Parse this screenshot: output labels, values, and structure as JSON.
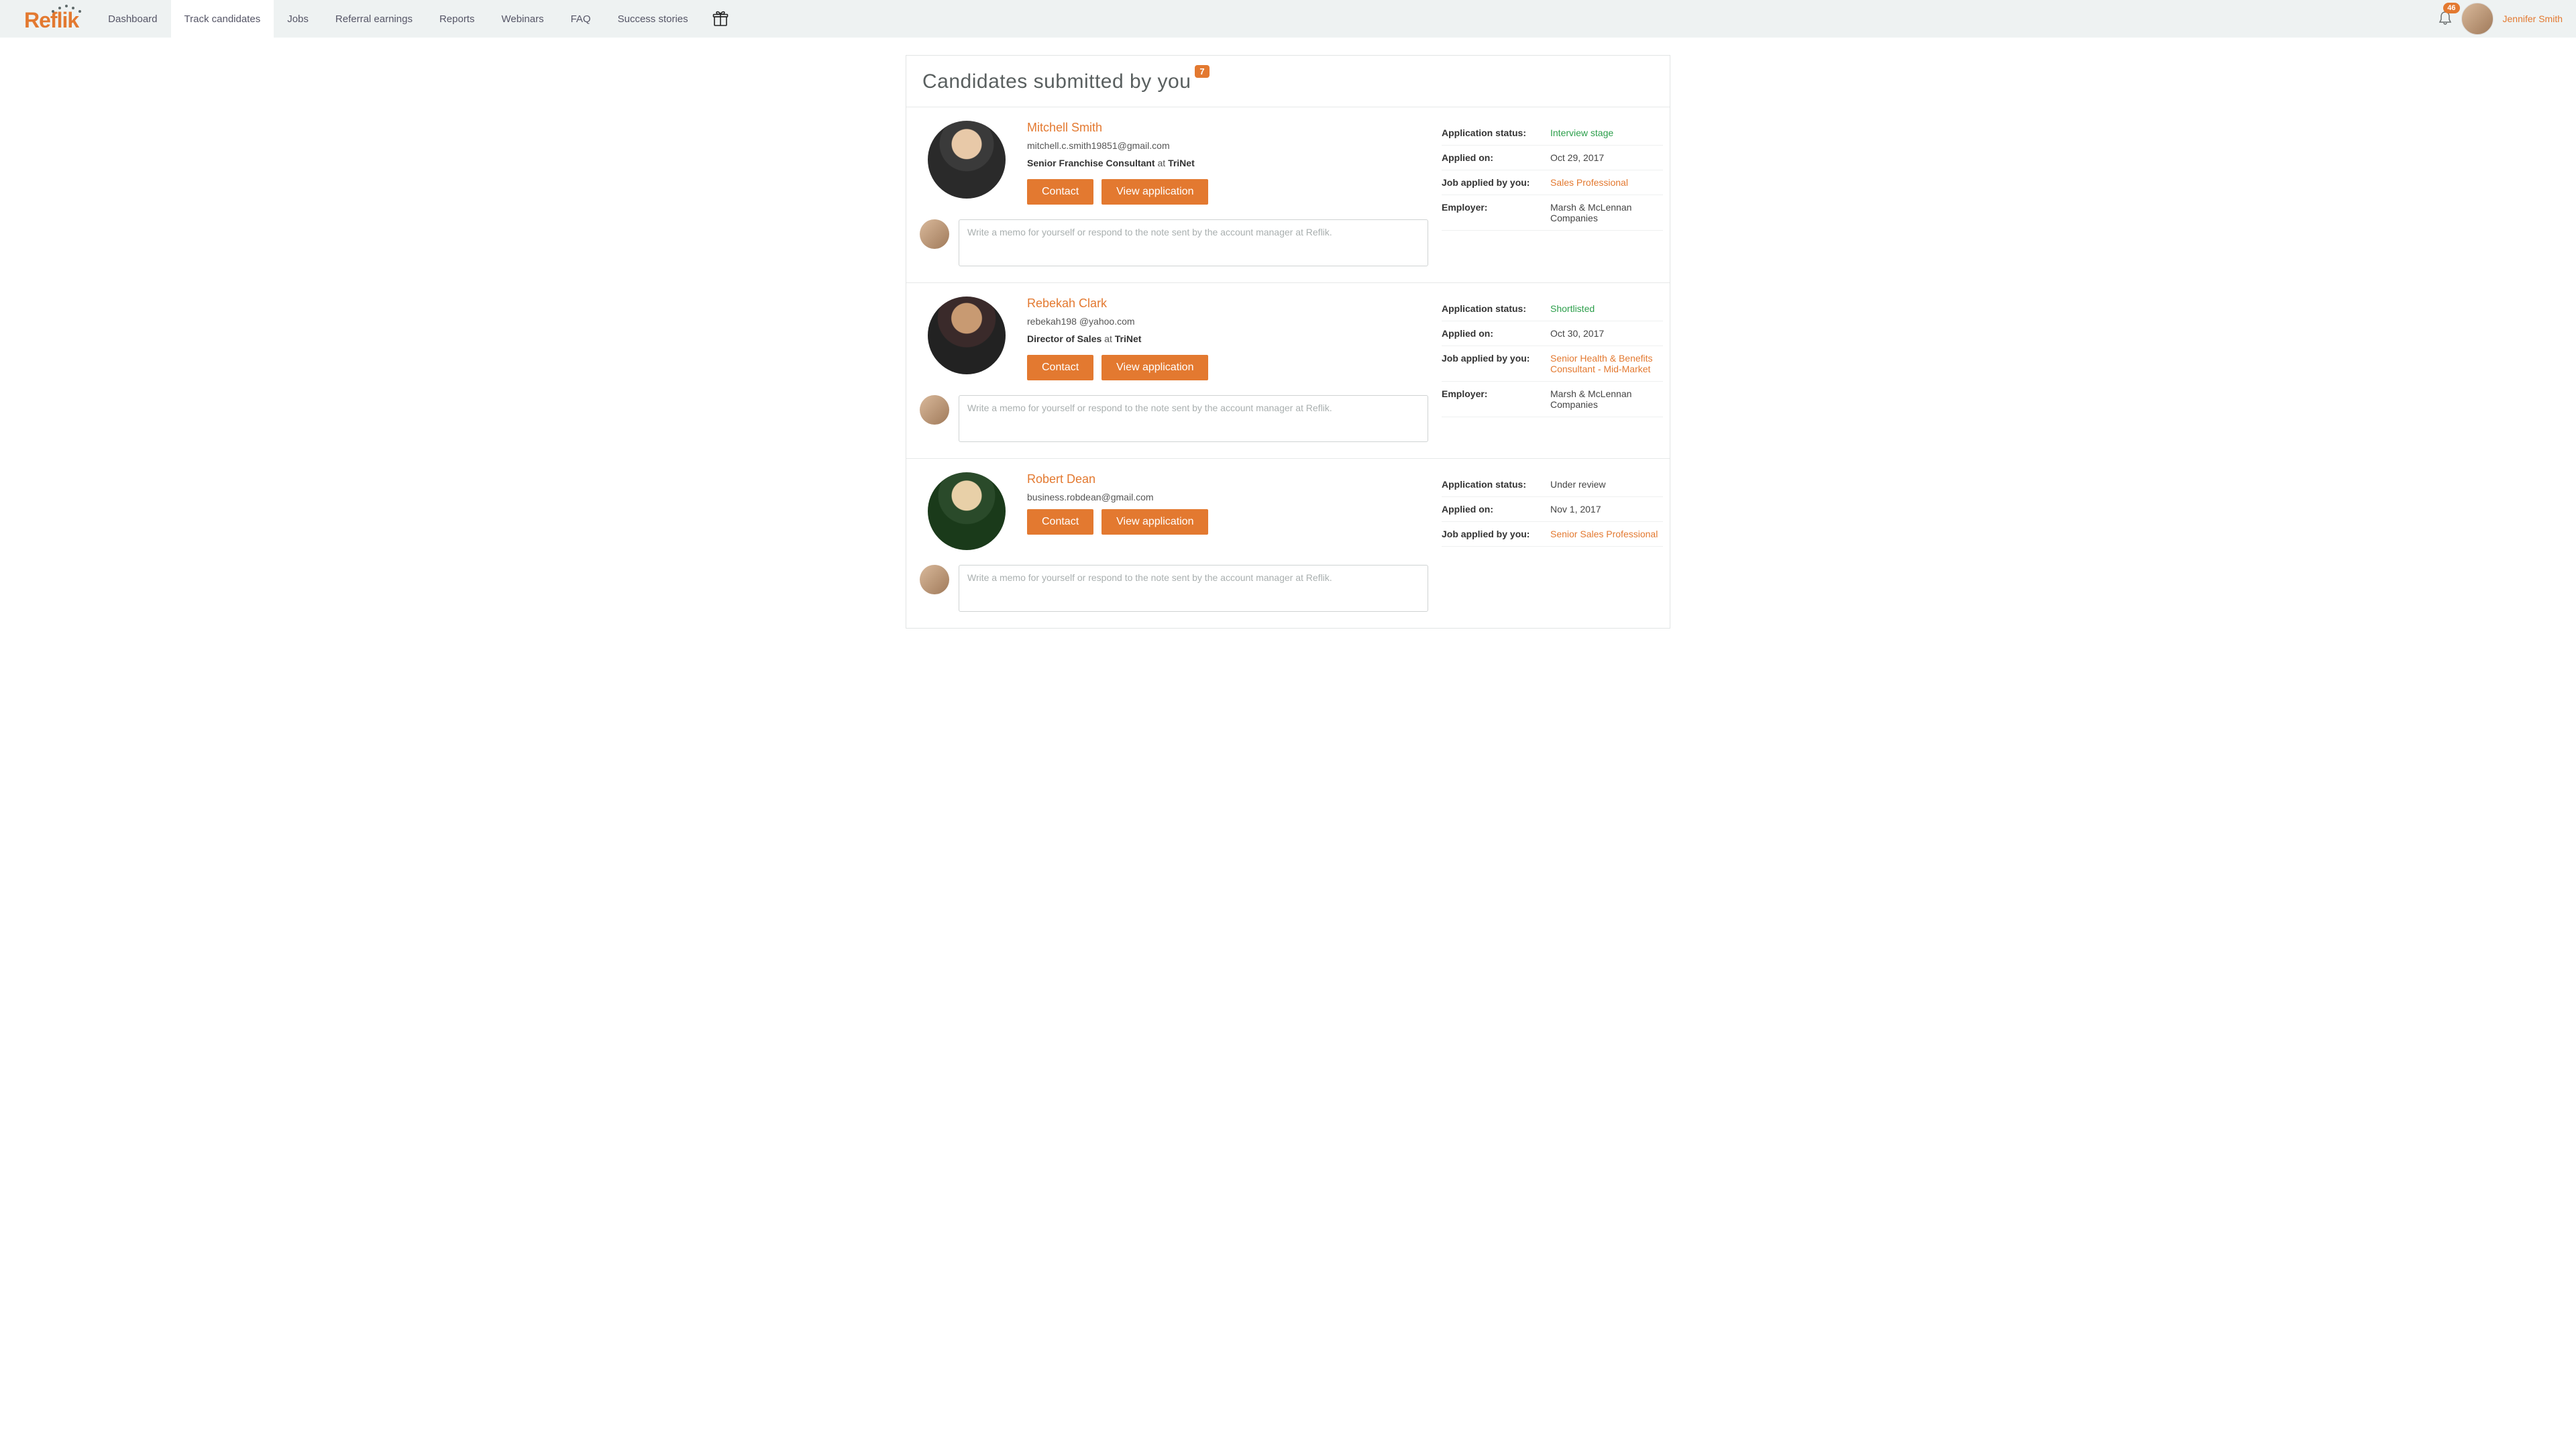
{
  "brand": "Reflik",
  "nav": {
    "items": [
      {
        "label": "Dashboard"
      },
      {
        "label": "Track candidates"
      },
      {
        "label": "Jobs"
      },
      {
        "label": "Referral earnings"
      },
      {
        "label": "Reports"
      },
      {
        "label": "Webinars"
      },
      {
        "label": "FAQ"
      },
      {
        "label": "Success stories"
      }
    ],
    "active_index": 1
  },
  "notifications": {
    "count": "46"
  },
  "user": {
    "name": "Jennifer Smith"
  },
  "page": {
    "title": "Candidates submitted by you",
    "count": "7"
  },
  "labels": {
    "status": "Application status:",
    "applied_on": "Applied on:",
    "job_applied": "Job applied by you:",
    "employer": "Employer:",
    "at": "at",
    "contact": "Contact",
    "view_app": "View application",
    "memo_placeholder": "Write a memo for yourself or respond to the note sent by the account manager at Reflik."
  },
  "candidates": [
    {
      "name": "Mitchell Smith",
      "email": "mitchell.c.smith19851@gmail.com",
      "role": "Senior Franchise Consultant",
      "org": "TriNet",
      "status": "Interview stage",
      "status_style": "green",
      "applied_on": "Oct 29, 2017",
      "job": "Sales Professional",
      "employer": "Marsh & McLennan Companies"
    },
    {
      "name": "Rebekah Clark",
      "email": "rebekah198 @yahoo.com",
      "role": "Director of Sales",
      "org": "TriNet",
      "status": "Shortlisted",
      "status_style": "green",
      "applied_on": "Oct 30, 2017",
      "job": "Senior Health & Benefits Consultant - Mid-Market",
      "employer": "Marsh & McLennan Companies"
    },
    {
      "name": "Robert Dean",
      "email": "business.robdean@gmail.com",
      "role": "",
      "org": "",
      "status": "Under review",
      "status_style": "",
      "applied_on": "Nov 1, 2017",
      "job": "Senior Sales Professional",
      "employer": ""
    }
  ]
}
